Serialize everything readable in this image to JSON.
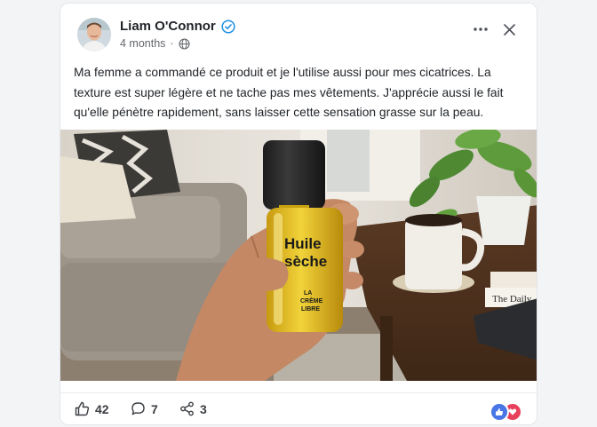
{
  "post": {
    "author": "Liam O'Connor",
    "timestamp": "4 months",
    "separator": "·",
    "text": "Ma femme a commandé ce produit et je l'utilise aussi pour mes cicatrices. La texture est super légère et ne tache pas mes vêtements. J'apprécie aussi le fait qu'elle pénètre rapidement, sans laisser cette sensation grasse sur la peau.",
    "image": {
      "product_name_line1": "Huile",
      "product_name_line2": "sèche",
      "brand_line1": "LA",
      "brand_line2": "CRÈME",
      "brand_line3": "LIBRE",
      "book_title": "The Daily"
    }
  },
  "footer": {
    "likes": "42",
    "comments": "7",
    "shares": "3"
  },
  "icons": {
    "verified": "verified-badge-icon",
    "visibility": "globe-icon",
    "more": "more-dots-icon",
    "close": "close-icon",
    "like": "thumbs-up-icon",
    "comment": "comment-bubble-icon",
    "share": "share-icon"
  },
  "colors": {
    "accent": "#1d8fe0",
    "like_reaction": "#4876e6",
    "love_reaction": "#e8405a",
    "oil": "#d9b21c"
  }
}
